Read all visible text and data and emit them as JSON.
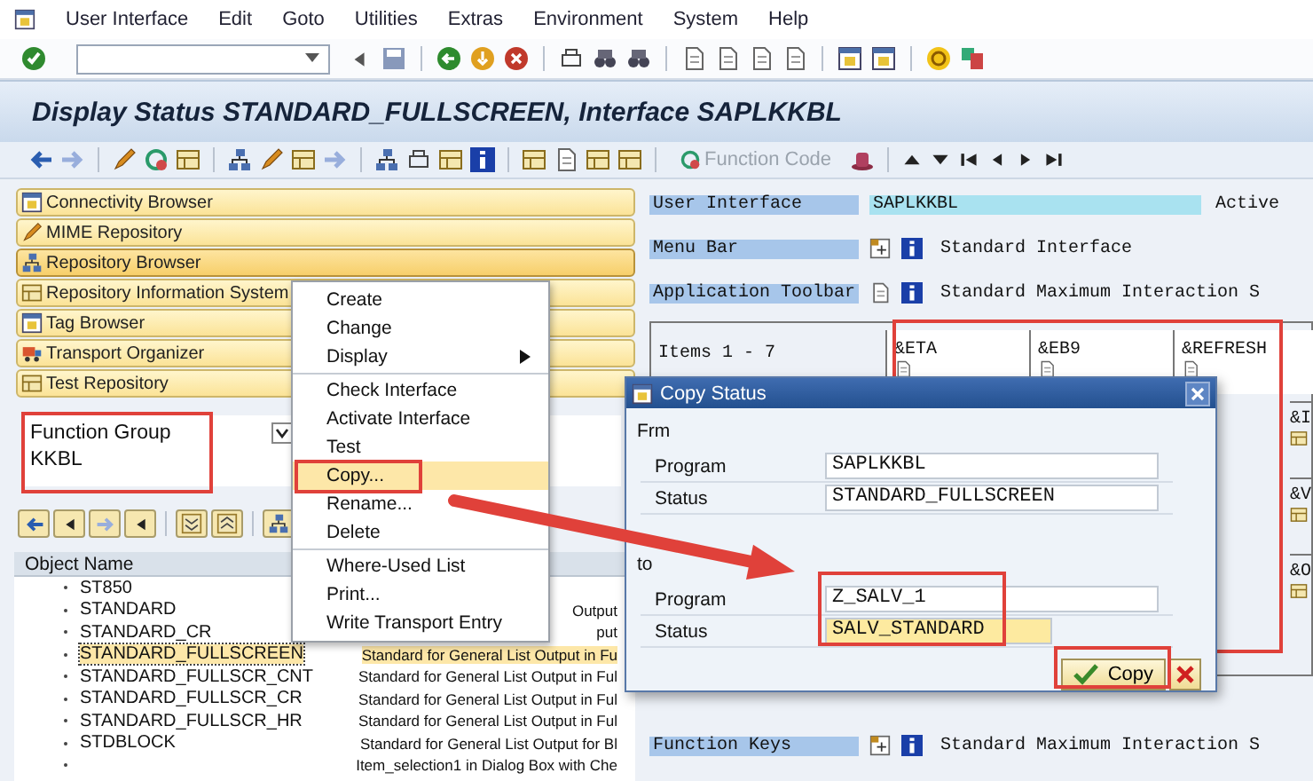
{
  "menu_bar": {
    "items": [
      "User Interface",
      "Edit",
      "Goto",
      "Utilities",
      "Extras",
      "Environment",
      "System",
      "Help"
    ]
  },
  "title": "Display Status STANDARD_FULLSCREEN, Interface SAPLKKBL",
  "app_toolbar": {
    "function_code": {
      "label": "Function Code",
      "disabled": true
    }
  },
  "browsers": [
    {
      "label": "Connectivity Browser",
      "selected": false
    },
    {
      "label": "MIME Repository",
      "selected": false
    },
    {
      "label": "Repository Browser",
      "selected": true
    },
    {
      "label": "Repository Information System",
      "selected": false
    },
    {
      "label": "Tag Browser",
      "selected": false
    },
    {
      "label": "Transport Organizer",
      "selected": false
    },
    {
      "label": "Test Repository",
      "selected": false
    }
  ],
  "object_selection": {
    "type": "Function Group",
    "name": "KKBL"
  },
  "tree": {
    "column": "Object Name",
    "rows": [
      {
        "name": "ST850",
        "selected": false
      },
      {
        "name": "STANDARD",
        "description": "Output",
        "selected": false
      },
      {
        "name": "STANDARD_CR",
        "description": "put",
        "selected": false
      },
      {
        "name": "STANDARD_FULLSCREEN",
        "description": "Standard for General List Output in Fu",
        "selected": true
      },
      {
        "name": "STANDARD_FULLSCR_CNT",
        "description": "Standard for General List Output in Ful",
        "selected": false
      },
      {
        "name": "STANDARD_FULLSCR_CR",
        "description": "Standard for General List Output in Ful",
        "selected": false
      },
      {
        "name": "STANDARD_FULLSCR_HR",
        "description": "Standard for General List Output in Ful",
        "selected": false
      },
      {
        "name": "STDBLOCK",
        "description": "Standard for General List Output for Bl",
        "selected": false
      },
      {
        "description": "Item_selection1 in Dialog Box with Che",
        "selected": false
      }
    ]
  },
  "context_menu": {
    "items": [
      {
        "kind": "item",
        "label": "Create",
        "selected": false
      },
      {
        "kind": "item",
        "label": "Change",
        "selected": false
      },
      {
        "kind": "submenu",
        "label": "Display",
        "selected": false
      },
      {
        "kind": "separator"
      },
      {
        "kind": "item",
        "label": "Check Interface",
        "selected": false
      },
      {
        "kind": "item",
        "label": "Activate Interface",
        "selected": false
      },
      {
        "kind": "item",
        "label": "Test",
        "selected": false
      },
      {
        "kind": "item",
        "label": "Copy...",
        "selected": true
      },
      {
        "kind": "item",
        "label": "Rename...",
        "selected": false
      },
      {
        "kind": "item",
        "label": "Delete",
        "selected": false
      },
      {
        "kind": "separator"
      },
      {
        "kind": "item",
        "label": "Where-Used List",
        "selected": false
      },
      {
        "kind": "item",
        "label": "Print...",
        "selected": false
      },
      {
        "kind": "item",
        "label": "Write Transport Entry",
        "selected": false
      }
    ]
  },
  "interface": {
    "label": "User Interface",
    "value": "SAPLKKBL",
    "state": "Active"
  },
  "components": [
    {
      "label": "Menu Bar",
      "text": "Standard Interface"
    },
    {
      "label": "Application Toolbar",
      "text": "Standard Maximum Interaction S"
    }
  ],
  "items_table": {
    "header": "Items  1 - 7",
    "codes": [
      "&ETA",
      "&EB9",
      "&REFRESH"
    ],
    "side_codes": [
      "&I",
      "&V",
      "&O"
    ]
  },
  "function_keys": {
    "label": "Function Keys",
    "text": "Standard Maximum Interaction S"
  },
  "dialog": {
    "title": "Copy Status",
    "groups": [
      {
        "label": "Frm",
        "fields": [
          {
            "label": "Program",
            "value": "SAPLKKBL",
            "focused": false
          },
          {
            "label": "Status",
            "value": "STANDARD_FULLSCREEN",
            "focused": false
          }
        ]
      },
      {
        "label": "to",
        "fields": [
          {
            "label": "Program",
            "value": "Z_SALV_1",
            "focused": false
          },
          {
            "label": "Status",
            "value": "SALV_STANDARD",
            "focused": true
          }
        ]
      }
    ],
    "buttons": [
      {
        "kind": "confirm",
        "label": "Copy"
      },
      {
        "kind": "cancel"
      }
    ]
  }
}
